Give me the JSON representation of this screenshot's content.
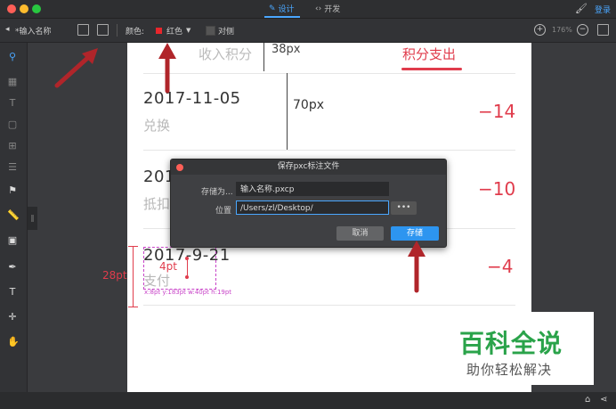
{
  "titlebar": {
    "tabs": [
      {
        "label": "设计",
        "icon": "pen-icon",
        "active": true
      },
      {
        "label": "开发",
        "icon": "code-icon",
        "active": false
      }
    ],
    "login_label": "登录"
  },
  "toolbar": {
    "doc_name": "*输入名称",
    "color_label": "颜色:",
    "color_value": "红色",
    "color_hex": "#e8262c",
    "opposite_label": "对侧",
    "zoom": "176%"
  },
  "canvas": {
    "header_tabs": [
      "收入积分",
      "38px",
      "积分支出"
    ],
    "rows": [
      {
        "date": "2017-11-05",
        "kind": "兑换",
        "amount": "−14",
        "measure": "70px"
      },
      {
        "date": "201",
        "kind": "抵扣",
        "amount": "−10"
      },
      {
        "date": "2017-9-21",
        "kind": "支付",
        "amount": "−4"
      }
    ],
    "measure_height": "28pt",
    "measure_gap": "4pt",
    "selection_coords": "x:8pt y:183pt w:40pt h:19pt"
  },
  "dialog": {
    "title": "保存pxc标注文件",
    "save_as_label": "存储为...",
    "save_as_value": "输入名称.pxcp",
    "location_label": "位置",
    "location_value": "/Users/zl/Desktop/",
    "browse_label": "•••",
    "cancel_label": "取消",
    "save_label": "存储"
  },
  "watermark": {
    "big": "百科全说",
    "small": "助你轻松解决"
  },
  "colors": {
    "accent": "#4aa7ff",
    "arrow": "#b0252a",
    "amount": "#e03c4c",
    "watermark": "#2aa34a"
  }
}
